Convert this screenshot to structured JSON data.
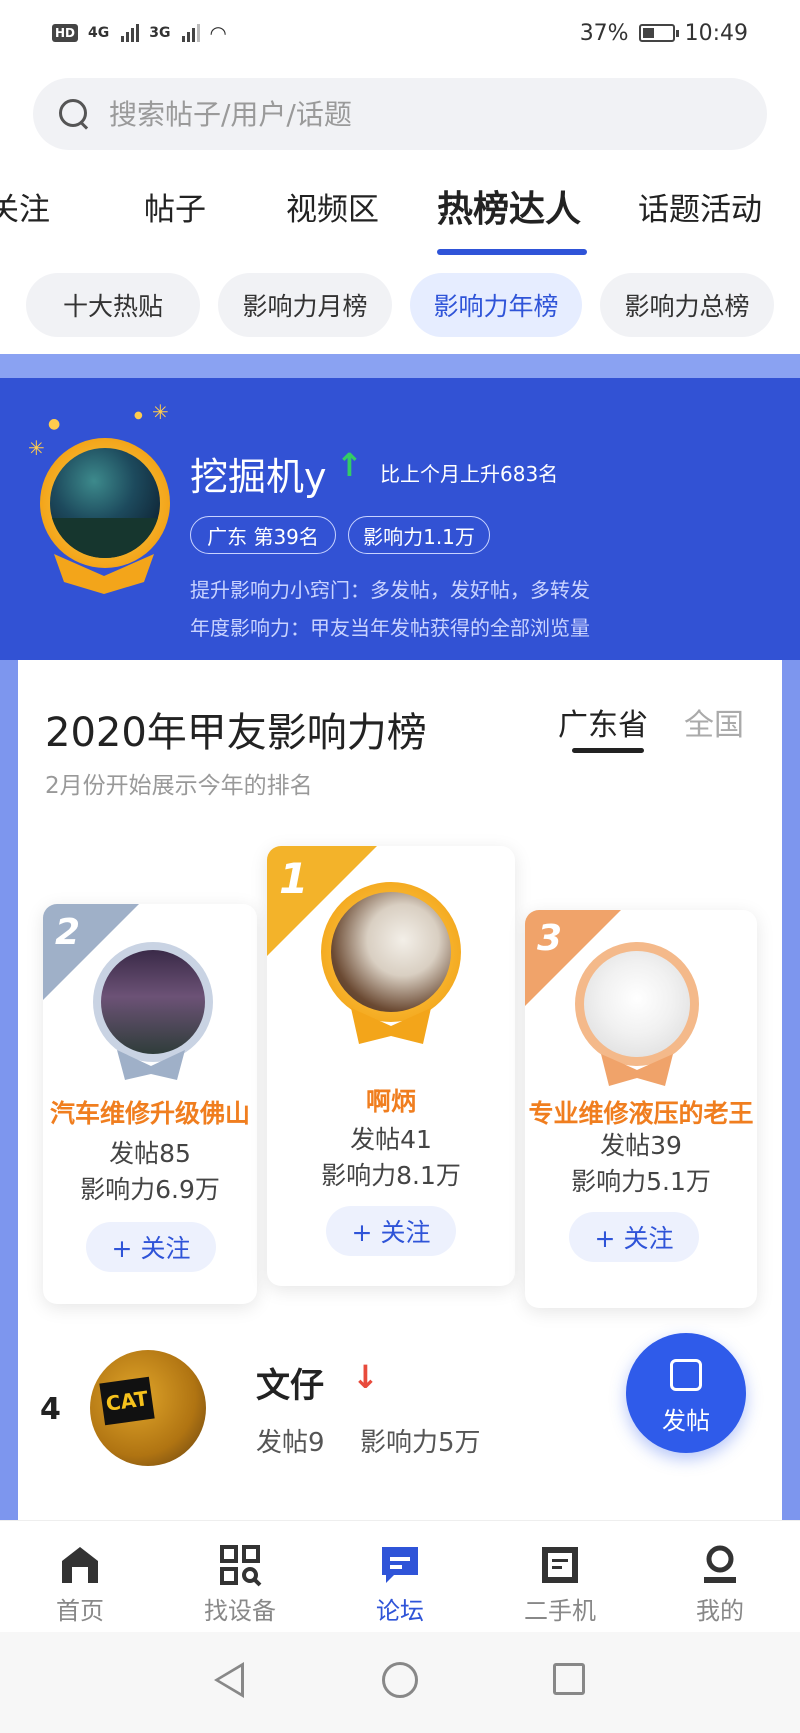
{
  "status_bar": {
    "hd": "HD",
    "net1": "4G",
    "net2": "3G",
    "battery": "37%",
    "time": "10:49"
  },
  "search": {
    "placeholder": "搜索帖子/用户/话题"
  },
  "tabs": [
    "关注",
    "帖子",
    "视频区",
    "热榜达人",
    "话题活动"
  ],
  "active_tab": "热榜达人",
  "chips": [
    "十大热贴",
    "影响力月榜",
    "影响力年榜",
    "影响力总榜"
  ],
  "active_chip": "影响力年榜",
  "me": {
    "name": "挖掘机y",
    "rise_text": "比上个月上升683名",
    "badge_region": "广东 第39名",
    "badge_influence": "影响力1.1万",
    "tip1": "提升影响力小窍门：多发帖，发好帖，多转发",
    "tip2": "年度影响力：甲友当年发帖获得的全部浏览量"
  },
  "board": {
    "title": "2020年甲友影响力榜",
    "subtitle": "2月份开始展示今年的排名",
    "region_on": "广东省",
    "region_off": "全国"
  },
  "podium": [
    {
      "rank": "2",
      "name": "汽车维修升级佛山",
      "posts": "发帖85",
      "influence": "影响力6.9万",
      "follow": "+ 关注"
    },
    {
      "rank": "1",
      "name": "啊炳",
      "posts": "发帖41",
      "influence": "影响力8.1万",
      "follow": "+ 关注"
    },
    {
      "rank": "3",
      "name": "专业维修液压的老王",
      "posts": "发帖39",
      "influence": "影响力5.1万",
      "follow": "+ 关注"
    }
  ],
  "row4": {
    "rank": "4",
    "name": "文仔",
    "posts": "发帖9",
    "influence": "影响力5万",
    "avatar_logo": "CAT"
  },
  "fab": {
    "label": "发帖"
  },
  "bottom_nav": [
    {
      "label": "首页",
      "icon": "home-icon"
    },
    {
      "label": "找设备",
      "icon": "grid-search-icon"
    },
    {
      "label": "论坛",
      "icon": "chat-icon"
    },
    {
      "label": "二手机",
      "icon": "document-icon"
    },
    {
      "label": "我的",
      "icon": "person-icon"
    }
  ],
  "active_nav": "论坛",
  "colors": {
    "accent": "#2f54d8",
    "banner": "#3252d4",
    "gold": "#f3a51a",
    "silver": "#9fb0c8",
    "bronze": "#f0a36a",
    "up": "#33cc66",
    "down": "#e84b3c"
  }
}
